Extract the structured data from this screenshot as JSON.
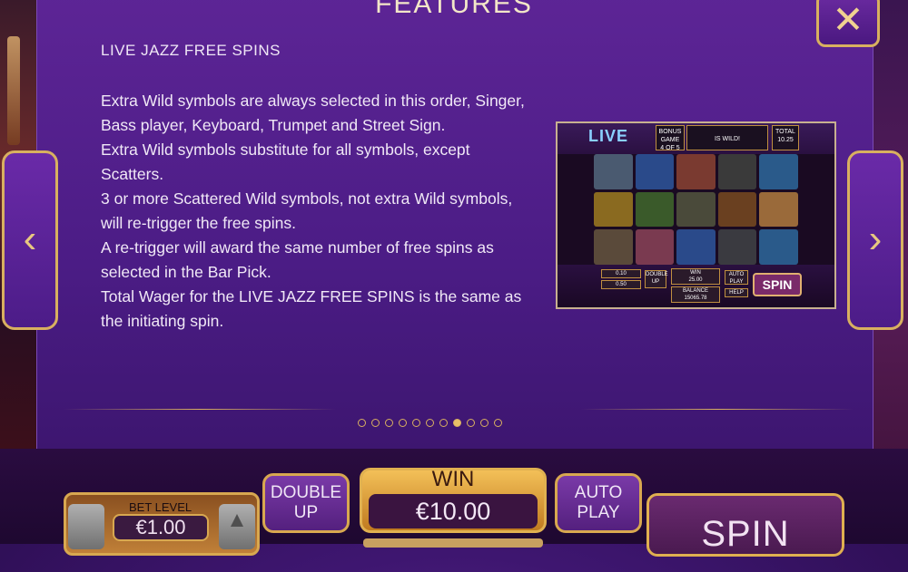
{
  "header": {
    "title": "FEATURES",
    "close_icon": "close-icon"
  },
  "content": {
    "heading": "LIVE JAZZ FREE SPINS",
    "paragraphs": [
      "Extra Wild symbols are always selected in this order, Singer, Bass player, Keyboard, Trumpet and Street Sign.",
      "Extra Wild symbols substitute for all symbols, except Scatters.",
      "3 or more Scattered Wild symbols, not extra Wild symbols, will re-trigger the free spins.",
      "A re-trigger will award the same number of free spins as selected in the Bar Pick.",
      "Total Wager for the LIVE JAZZ FREE SPINS is the same as the initiating spin."
    ]
  },
  "screenshot": {
    "logo": "LIVE",
    "bonus_game_label": "BONUS GAME",
    "bonus_game_value": "4 OF 5",
    "wild_label": "IS WILD!",
    "total_label": "TOTAL",
    "total_value": "10.25",
    "bet_values": [
      "0.10",
      "0.50"
    ],
    "double_up": "DOUBLE UP",
    "win_label": "WIN",
    "win_value": "25.00",
    "balance_label": "BALANCE",
    "balance_value": "15065.78",
    "auto_play": "AUTO PLAY",
    "help": "HELP",
    "spin": "SPIN"
  },
  "pagination": {
    "count": 11,
    "active_index": 7
  },
  "controls": {
    "bet_level_label": "BET LEVEL",
    "bet_level_value": "€1.00",
    "double_up_label": "DOUBLE UP",
    "win_label": "WIN",
    "win_value": "€10.00",
    "auto_play_label": "AUTO PLAY",
    "spin_label": "SPIN"
  },
  "colors": {
    "gold": "#d8b060",
    "purple": "#4b1c85",
    "text": "#f0e8f6"
  }
}
